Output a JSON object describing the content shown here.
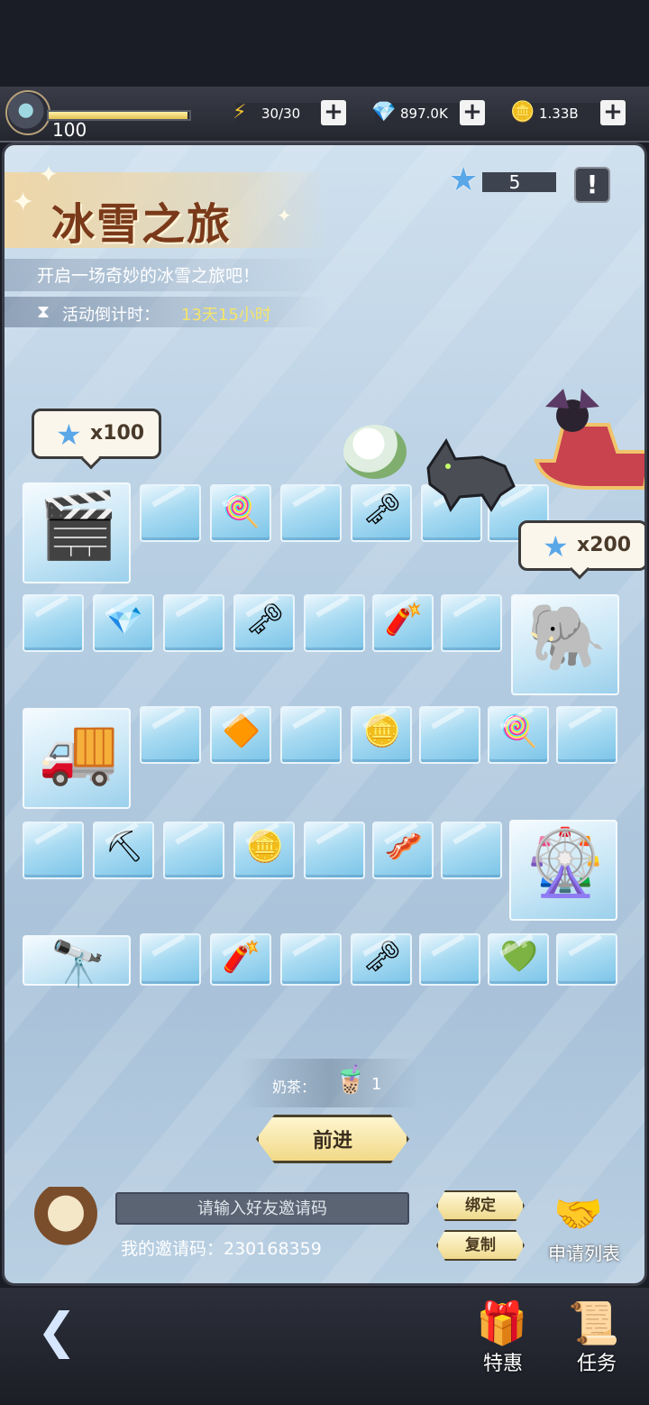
{
  "top_bar": {
    "level": "100",
    "level_progress": 0.99,
    "energy": "30/30",
    "gems": "897.0K",
    "coins": "1.33B",
    "energy_icon": "⚡",
    "gem_icon": "💎",
    "coin_icon": "🪙",
    "plus": "+"
  },
  "event": {
    "title": "冰雪之旅",
    "subtitle": "开启一场奇妙的冰雪之旅吧！",
    "countdown_label": "活动倒计时：",
    "countdown_value": "13天15小时",
    "stars": "5",
    "info": "!"
  },
  "board": {
    "reward_a": "x100",
    "reward_b": "x200",
    "star_glyph": "★"
  },
  "actions": {
    "milk_tea_label": "奶茶：",
    "milk_tea_count": "1",
    "go_label": "前进",
    "invite_placeholder": "请输入好友邀请码",
    "my_code_label": "我的邀请码：230168359",
    "bind_label": "绑定",
    "copy_label": "复制",
    "apply_list_label": "申请列表"
  },
  "footer": {
    "special_label": "特惠",
    "task_label": "任务"
  },
  "colors": {
    "accent_gold": "#f1d987",
    "countdown": "#f5e46a",
    "star_blue": "#5aa7e8"
  }
}
